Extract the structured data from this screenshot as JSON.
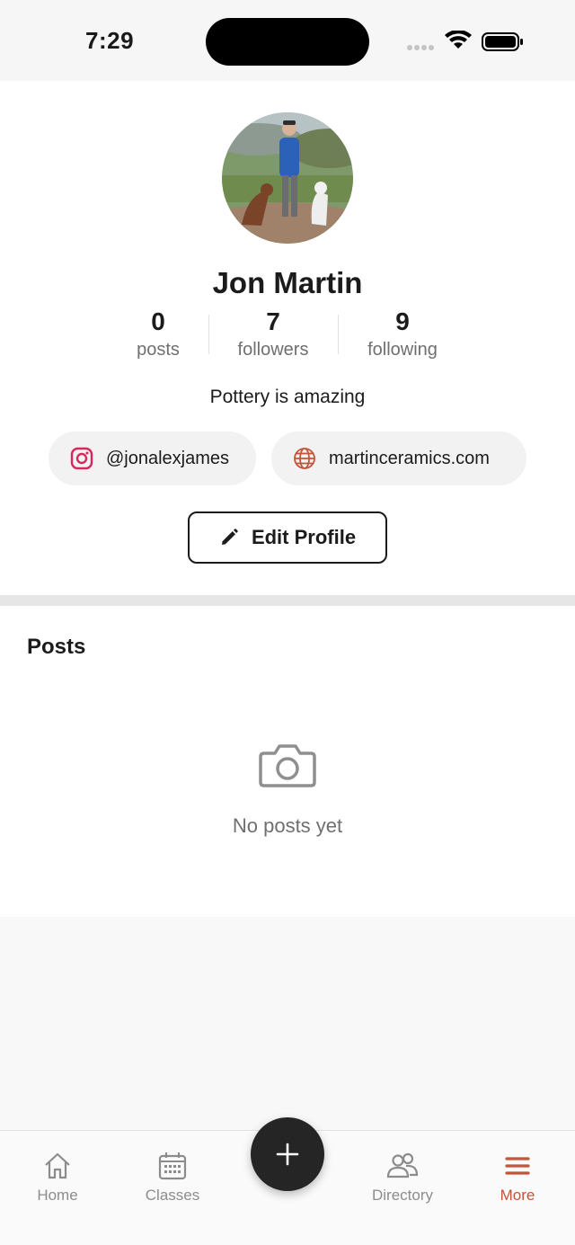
{
  "status_bar": {
    "time": "7:29"
  },
  "profile": {
    "name": "Jon Martin",
    "stats": [
      {
        "value": "0",
        "label": "posts"
      },
      {
        "value": "7",
        "label": "followers"
      },
      {
        "value": "9",
        "label": "following"
      }
    ],
    "bio": "Pottery is amazing",
    "instagram": "@jonalexjames",
    "website": "martinceramics.com",
    "edit_label": "Edit Profile"
  },
  "posts": {
    "title": "Posts",
    "empty_text": "No posts yet"
  },
  "tabbar": {
    "tabs": [
      {
        "label": "Home",
        "icon": "home-icon"
      },
      {
        "label": "Classes",
        "icon": "calendar-icon"
      },
      {
        "label": "Directory",
        "icon": "people-icon"
      },
      {
        "label": "More",
        "icon": "menu-icon"
      }
    ],
    "active_tab": "More",
    "fab_icon": "plus-icon"
  },
  "colors": {
    "accent": "#c2553a",
    "instagram": "#d6285f",
    "fab": "#252525"
  }
}
